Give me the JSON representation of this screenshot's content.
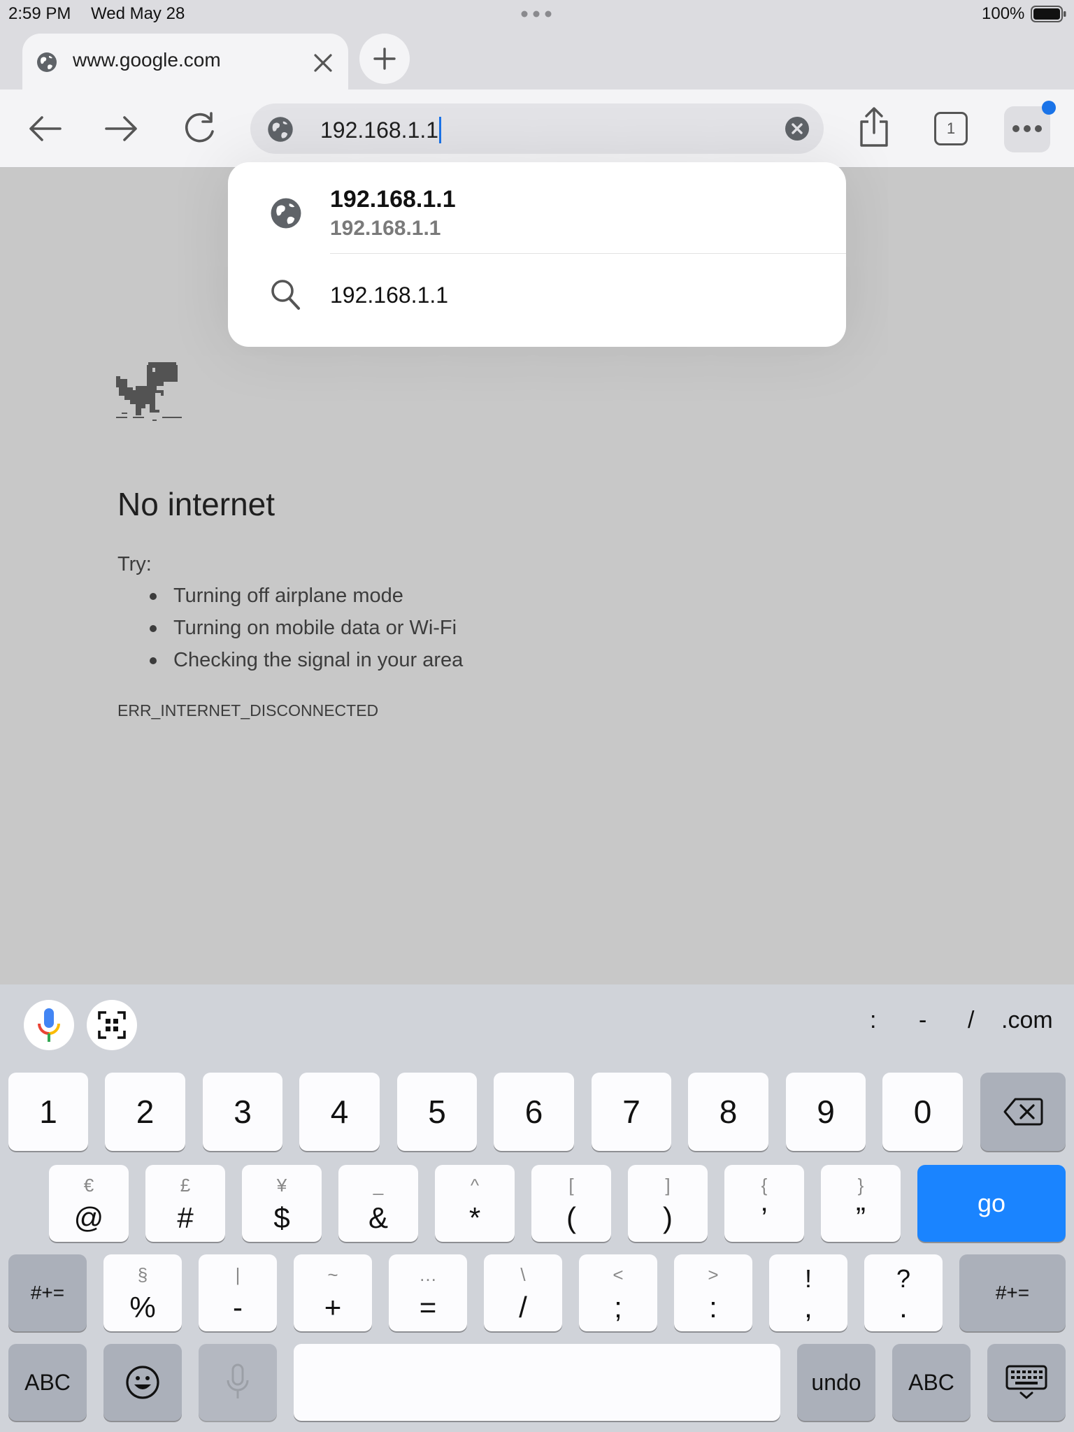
{
  "status": {
    "time": "2:59 PM",
    "date": "Wed May 28",
    "battery": "100%"
  },
  "tab": {
    "title": "www.google.com"
  },
  "toolbar": {
    "url": "192.168.1.1",
    "tab_count": "1"
  },
  "suggestions": [
    {
      "title": "192.168.1.1",
      "subtitle": "192.168.1.1",
      "icon": "globe-icon"
    },
    {
      "title": "192.168.1.1",
      "icon": "search-icon"
    }
  ],
  "error_page": {
    "title": "No internet",
    "try_label": "Try:",
    "suggestions": [
      "Turning off airplane mode",
      "Turning on mobile data or Wi-Fi",
      "Checking the signal in your area"
    ],
    "code": "ERR_INTERNET_DISCONNECTED"
  },
  "keyboard": {
    "shortcuts": [
      ":",
      "-",
      "/",
      ".com"
    ],
    "row1": [
      "1",
      "2",
      "3",
      "4",
      "5",
      "6",
      "7",
      "8",
      "9",
      "0"
    ],
    "row2": [
      {
        "upper": "€",
        "lower": "@"
      },
      {
        "upper": "£",
        "lower": "#"
      },
      {
        "upper": "¥",
        "lower": "$"
      },
      {
        "upper": "_",
        "lower": "&"
      },
      {
        "upper": "^",
        "lower": "*"
      },
      {
        "upper": "[",
        "lower": "("
      },
      {
        "upper": "]",
        "lower": ")"
      },
      {
        "upper": "{",
        "lower": "’"
      },
      {
        "upper": "}",
        "lower": "”"
      }
    ],
    "go_label": "go",
    "row3_mode_label": "#+=",
    "row3": [
      {
        "upper": "§",
        "lower": "%"
      },
      {
        "upper": "|",
        "lower": "-"
      },
      {
        "upper": "~",
        "lower": "+"
      },
      {
        "upper": "…",
        "lower": "="
      },
      {
        "upper": "\\",
        "lower": "/"
      },
      {
        "upper": "<",
        "lower": ";"
      },
      {
        "upper": ">",
        "lower": ":"
      },
      {
        "upper": "!",
        "lower": ","
      },
      {
        "upper": "?",
        "lower": "."
      }
    ],
    "abc_label": "ABC",
    "undo_label": "undo"
  },
  "colors": {
    "accent": "#1a73e8",
    "go_key": "#1a84ff"
  }
}
